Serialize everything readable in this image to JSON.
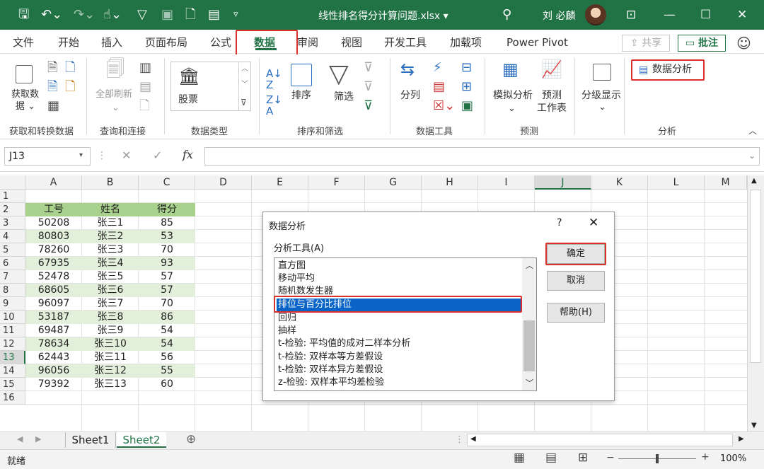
{
  "titlebar": {
    "title": "线性排名得分计算问题.xlsx ▾",
    "user": "刘 必麟",
    "quick_icons": [
      "save-icon",
      "undo-icon",
      "redo-icon",
      "touch-mode-icon",
      "filter-icon",
      "camera-icon",
      "new-file-icon",
      "form-icon",
      "customize-icon"
    ],
    "window_controls": [
      "ribbon-display-icon",
      "minimize-icon",
      "maximize-icon",
      "close-icon"
    ]
  },
  "tabs": [
    "文件",
    "开始",
    "插入",
    "页面布局",
    "公式",
    "数据",
    "审阅",
    "视图",
    "开发工具",
    "加载项",
    "Power Pivot"
  ],
  "active_tab": "数据",
  "share_label": "⇪ 共享",
  "comments_label": "▭ 批注",
  "ribbon": {
    "get_data": "获取数",
    "get_data2": "据 ⌄",
    "refresh_all": "全部刷新",
    "stocks": "股票",
    "sort": "排序",
    "filter": "筛选",
    "split_columns": "分列",
    "what_if": "模拟分析",
    "forecast1": "预测",
    "forecast2": "工作表",
    "outline": "分级显示",
    "data_analysis": "数据分析",
    "groups": [
      "获取和转换数据",
      "查询和连接",
      "数据类型",
      "排序和筛选",
      "数据工具",
      "预测",
      "分析"
    ]
  },
  "formula_bar": {
    "name_box": "J13",
    "fx": "fx",
    "value": ""
  },
  "columns": [
    "A",
    "B",
    "C",
    "D",
    "E",
    "F",
    "G",
    "H",
    "I",
    "J",
    "K",
    "L",
    "M"
  ],
  "rows": [
    "1",
    "2",
    "3",
    "4",
    "5",
    "6",
    "7",
    "8",
    "9",
    "10",
    "11",
    "12",
    "13",
    "14",
    "15",
    "16"
  ],
  "table": {
    "headers": [
      "工号",
      "姓名",
      "得分"
    ],
    "rows": [
      [
        "50208",
        "张三1",
        "85"
      ],
      [
        "80803",
        "张三2",
        "53"
      ],
      [
        "78260",
        "张三3",
        "70"
      ],
      [
        "67935",
        "张三4",
        "93"
      ],
      [
        "52478",
        "张三5",
        "57"
      ],
      [
        "68605",
        "张三6",
        "57"
      ],
      [
        "96097",
        "张三7",
        "70"
      ],
      [
        "53187",
        "张三8",
        "86"
      ],
      [
        "69487",
        "张三9",
        "54"
      ],
      [
        "78634",
        "张三10",
        "54"
      ],
      [
        "62443",
        "张三11",
        "56"
      ],
      [
        "96056",
        "张三12",
        "55"
      ],
      [
        "79392",
        "张三13",
        "60"
      ]
    ]
  },
  "dialog": {
    "title": "数据分析",
    "help": "?",
    "close": "✕",
    "list_label": "分析工具(A)",
    "items": [
      "直方图",
      "移动平均",
      "随机数发生器",
      "排位与百分比排位",
      "回归",
      "抽样",
      "t-检验: 平均值的成对二样本分析",
      "t-检验: 双样本等方差假设",
      "t-检验: 双样本异方差假设",
      "z-检验: 双样本平均差检验"
    ],
    "selected_item": "排位与百分比排位",
    "ok": "确定",
    "cancel": "取消",
    "help_button": "帮助(H)"
  },
  "sheets": [
    "Sheet1",
    "Sheet2"
  ],
  "active_sheet": "Sheet2",
  "status": {
    "ready": "就绪",
    "zoom": "100%"
  },
  "colors": {
    "excel_green": "#217346",
    "header_green": "#a9d18e",
    "band_green": "#e2efda",
    "highlight_red": "#d9302c",
    "selection_blue": "#0a64c8"
  }
}
